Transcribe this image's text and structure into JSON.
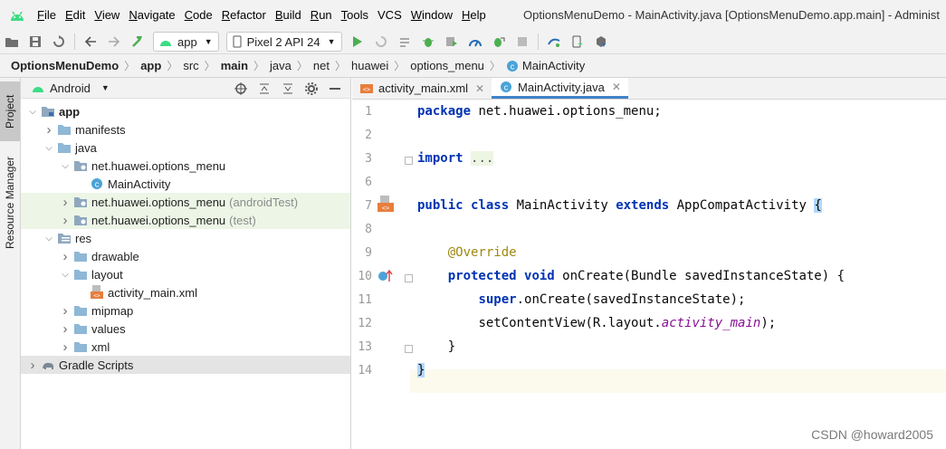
{
  "colors": {
    "accent": "#4083c9",
    "android_green": "#3ddc84",
    "run_green": "#4caf50",
    "keyword": "#0033b3",
    "annotation": "#9e880d",
    "field": "#871094"
  },
  "menubar": {
    "items": [
      {
        "label": "File",
        "mnemonic": "F",
        "rest": "ile"
      },
      {
        "label": "Edit",
        "mnemonic": "E",
        "rest": "dit"
      },
      {
        "label": "View",
        "mnemonic": "V",
        "rest": "iew"
      },
      {
        "label": "Navigate",
        "mnemonic": "N",
        "rest": "avigate"
      },
      {
        "label": "Code",
        "mnemonic": "C",
        "rest": "ode"
      },
      {
        "label": "Refactor",
        "mnemonic": "R",
        "rest": "efactor"
      },
      {
        "label": "Build",
        "mnemonic": "B",
        "rest": "uild"
      },
      {
        "label": "Run",
        "mnemonic": "R",
        "rest": "un"
      },
      {
        "label": "Tools",
        "mnemonic": "T",
        "rest": "ools"
      },
      {
        "label": "VCS",
        "mnemonic": "",
        "rest": "VCS"
      },
      {
        "label": "Window",
        "mnemonic": "W",
        "rest": "indow"
      },
      {
        "label": "Help",
        "mnemonic": "H",
        "rest": "elp"
      }
    ],
    "window_title": "OptionsMenuDemo - MainActivity.java [OptionsMenuDemo.app.main] - Administ"
  },
  "toolbar": {
    "run_config": "app",
    "device": "Pixel 2 API 24"
  },
  "breadcrumb": [
    "OptionsMenuDemo",
    "app",
    "src",
    "main",
    "java",
    "net",
    "huawei",
    "options_menu",
    "MainActivity"
  ],
  "left_strip": {
    "project": "Project",
    "resource_manager": "Resource Manager"
  },
  "project_panel": {
    "view": "Android",
    "tree": [
      {
        "label": "app",
        "suffix": "",
        "icon": "module-folder-icon",
        "depth": 0,
        "expanded": true,
        "bold": true,
        "hl": ""
      },
      {
        "label": "manifests",
        "suffix": "",
        "icon": "folder-icon",
        "depth": 1,
        "expanded": false,
        "bold": false,
        "hl": ""
      },
      {
        "label": "java",
        "suffix": "",
        "icon": "folder-icon",
        "depth": 1,
        "expanded": true,
        "bold": false,
        "hl": ""
      },
      {
        "label": "net.huawei.options_menu",
        "suffix": "",
        "icon": "package-icon",
        "depth": 2,
        "expanded": true,
        "bold": false,
        "hl": ""
      },
      {
        "label": "MainActivity",
        "suffix": "",
        "icon": "class-icon",
        "depth": 3,
        "expanded": null,
        "bold": false,
        "hl": ""
      },
      {
        "label": "net.huawei.options_menu",
        "suffix": "(androidTest)",
        "icon": "package-icon",
        "depth": 2,
        "expanded": false,
        "bold": false,
        "hl": "green"
      },
      {
        "label": "net.huawei.options_menu",
        "suffix": "(test)",
        "icon": "package-icon",
        "depth": 2,
        "expanded": false,
        "bold": false,
        "hl": "green"
      },
      {
        "label": "res",
        "suffix": "",
        "icon": "res-folder-icon",
        "depth": 1,
        "expanded": true,
        "bold": false,
        "hl": ""
      },
      {
        "label": "drawable",
        "suffix": "",
        "icon": "folder-icon",
        "depth": 2,
        "expanded": false,
        "bold": false,
        "hl": ""
      },
      {
        "label": "layout",
        "suffix": "",
        "icon": "folder-icon",
        "depth": 2,
        "expanded": true,
        "bold": false,
        "hl": ""
      },
      {
        "label": "activity_main.xml",
        "suffix": "",
        "icon": "xml-file-icon",
        "depth": 3,
        "expanded": null,
        "bold": false,
        "hl": ""
      },
      {
        "label": "mipmap",
        "suffix": "",
        "icon": "folder-icon",
        "depth": 2,
        "expanded": false,
        "bold": false,
        "hl": ""
      },
      {
        "label": "values",
        "suffix": "",
        "icon": "folder-icon",
        "depth": 2,
        "expanded": false,
        "bold": false,
        "hl": ""
      },
      {
        "label": "xml",
        "suffix": "",
        "icon": "folder-icon",
        "depth": 2,
        "expanded": false,
        "bold": false,
        "hl": ""
      },
      {
        "label": "Gradle Scripts",
        "suffix": "",
        "icon": "gradle-icon",
        "depth": 0,
        "expanded": false,
        "bold": false,
        "hl": "gray"
      }
    ]
  },
  "editor": {
    "tabs": [
      {
        "label": "activity_main.xml",
        "icon": "xml-file-icon",
        "active": false
      },
      {
        "label": "MainActivity.java",
        "icon": "class-icon",
        "active": true
      }
    ],
    "line_numbers": [
      "1",
      "2",
      "3",
      "6",
      "7",
      "8",
      "9",
      "10",
      "11",
      "12",
      "13",
      "14"
    ],
    "code": {
      "l1_kw": "package",
      "l1_rest": " net.huawei.options_menu;",
      "l3_kw": "import",
      "l3_dots": "...",
      "l7_kw1": "public",
      "l7_kw2": "class",
      "l7_name": " MainActivity ",
      "l7_kw3": "extends",
      "l7_rest": " AppCompatActivity ",
      "l7_brace": "{",
      "l9_ann": "@Override",
      "l10_kw1": "protected",
      "l10_kw2": "void",
      "l10_rest": " onCreate(Bundle savedInstanceState) {",
      "l11_kw": "super",
      "l11_rest": ".onCreate(savedInstanceState);",
      "l12_a": "setContentView(R.layout.",
      "l12_fld": "activity_main",
      "l12_b": ");",
      "l13": "}",
      "l14": "}"
    }
  },
  "watermark": "CSDN @howard2005"
}
